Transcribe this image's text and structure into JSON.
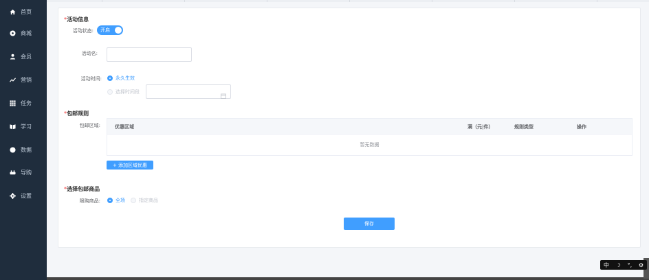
{
  "sidebar": {
    "items": [
      {
        "label": "首页",
        "icon": "home-icon"
      },
      {
        "label": "商城",
        "icon": "mall-icon"
      },
      {
        "label": "会员",
        "icon": "member-icon"
      },
      {
        "label": "营销",
        "icon": "trend-icon"
      },
      {
        "label": "任务",
        "icon": "grid-icon"
      },
      {
        "label": "学习",
        "icon": "book-icon"
      },
      {
        "label": "数据",
        "icon": "data-icon"
      },
      {
        "label": "导购",
        "icon": "guide-icon"
      },
      {
        "label": "设置",
        "icon": "gear-icon"
      }
    ]
  },
  "activity": {
    "title_req": "*",
    "title": "活动信息",
    "status_label": "活动状态:",
    "status_switch": "开启",
    "name_label": "活动名:",
    "name_value": "",
    "time_label": "活动时间:",
    "time_option_forever": "永久生效",
    "time_option_range": "选择时间段"
  },
  "shipping": {
    "title_req": "*",
    "title": "包邮规则",
    "region_label": "包邮区域:",
    "columns": [
      "优惠区域",
      "满（元|件）",
      "规则类型",
      "操作"
    ],
    "empty_text": "暂无数据",
    "add_button": "+ 添加区域优惠"
  },
  "goods": {
    "title_req": "*",
    "title": "选择包邮商品",
    "limit_label": "限购商品:",
    "option_all": "全场",
    "option_specific": "指定商品"
  },
  "save_button": "保存",
  "ime": {
    "lang": "中",
    "moon": "☽",
    "punct": "°,",
    "settings": "⚙"
  },
  "colors": {
    "accent": "#409eff",
    "sidebar_bg": "#1f2d3d",
    "required": "#f56c6c"
  }
}
